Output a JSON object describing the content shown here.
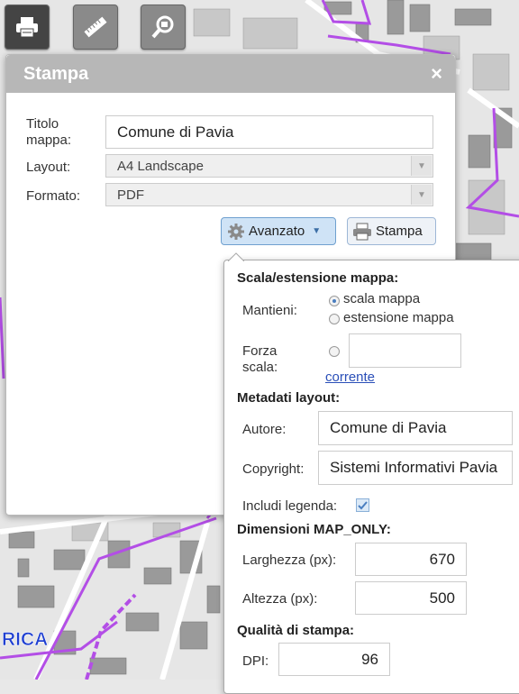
{
  "map": {
    "label_text": "RICA"
  },
  "toolbar": {
    "buttons": [
      {
        "name": "print-tool",
        "icon": "printer-icon",
        "active": true
      },
      {
        "name": "measure-tool",
        "icon": "ruler-icon",
        "active": false
      },
      {
        "name": "search-tool",
        "icon": "magnifier-icon",
        "active": false
      }
    ]
  },
  "dialog": {
    "title": "Stampa",
    "close_symbol": "×",
    "titolo_label": "Titolo mappa:",
    "titolo_value": "Comune di Pavia",
    "layout_label": "Layout:",
    "layout_value": "A4 Landscape",
    "formato_label": "Formato:",
    "formato_value": "PDF",
    "advanced_label": "Avanzato",
    "print_label": "Stampa"
  },
  "advanced": {
    "scale_section": "Scala/estensione mappa:",
    "mantieni_label": "Mantieni:",
    "option_scale": "scala mappa",
    "option_extent": "estensione mappa",
    "selected_option": "scala mappa",
    "forza_label": "Forza scala:",
    "forza_value": "",
    "current_link": "corrente",
    "metadata_section": "Metadati layout:",
    "autore_label": "Autore:",
    "autore_value": "Comune di Pavia",
    "copyright_label": "Copyright:",
    "copyright_value": "Sistemi Informativi Pavia",
    "legend_label": "Includi legenda:",
    "legend_checked": true,
    "mapsize_section": "Dimensioni MAP_ONLY:",
    "width_label": "Larghezza (px):",
    "width_value": "670",
    "height_label": "Altezza (px):",
    "height_value": "500",
    "quality_section": "Qualità di stampa:",
    "dpi_label": "DPI:",
    "dpi_value": "96"
  },
  "colors": {
    "boundary": "#b34ee6",
    "header": "#b7b7b7",
    "link": "#2a4fb8",
    "map_label": "#1f3fd1"
  }
}
